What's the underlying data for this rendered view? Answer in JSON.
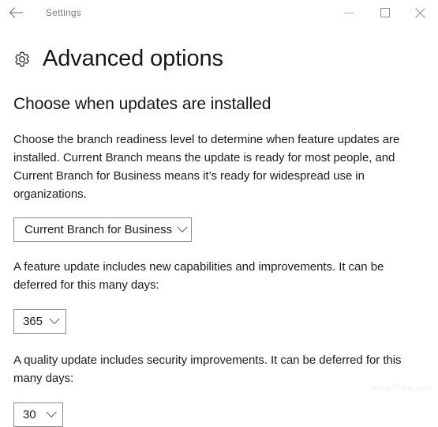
{
  "window": {
    "title": "Settings",
    "back_icon": "back-arrow-icon",
    "controls": {
      "minimize": "minimize-icon",
      "maximize": "maximize-icon",
      "close": "close-icon"
    }
  },
  "page": {
    "icon": "gear-icon",
    "title": "Advanced options",
    "section_heading": "Choose when updates are installed",
    "paragraph_branch": "Choose the branch readiness level to determine when feature updates are installed. Current Branch means the update is ready for most people, and Current Branch for Business means it’s ready for widespread use in organizations.",
    "paragraph_feature": "A feature update includes new capabilities and improvements. It can be deferred for this many days:",
    "paragraph_quality": "A quality update includes security improvements. It can be deferred for this many days:"
  },
  "controls": {
    "branch_readiness": {
      "value": "Current Branch for Business",
      "chevron": "chevron-down-icon"
    },
    "feature_defer_days": {
      "value": "365",
      "chevron": "chevron-down-icon"
    },
    "quality_defer_days": {
      "value": "30",
      "chevron": "chevron-down-icon"
    }
  },
  "watermark": {
    "text": "www.fifam.com"
  },
  "colors": {
    "background": "#ffffff",
    "text_primary": "#1c1c1c",
    "text_title": "#171717",
    "titlebar_text": "#7b7b7b",
    "control_border": "#8c8c8c",
    "icon_stroke": "#5a5a5a",
    "watermark": "#f1f1f1"
  }
}
